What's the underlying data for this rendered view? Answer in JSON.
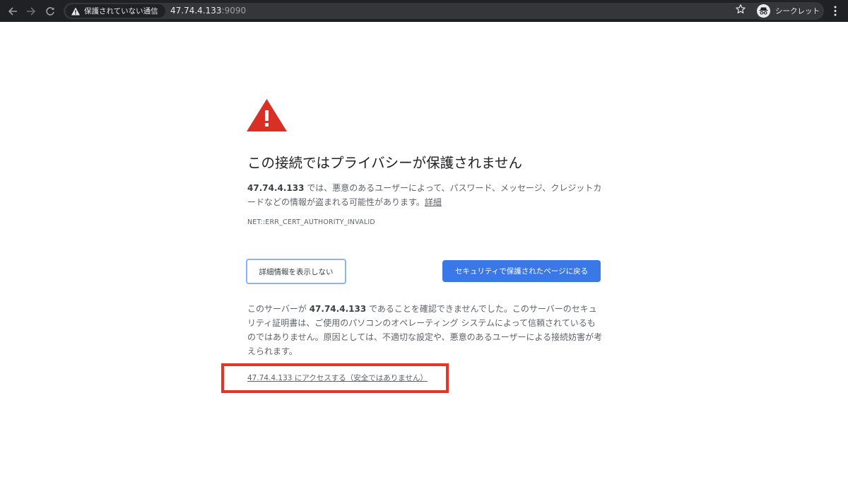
{
  "browser": {
    "security_chip_label": "保護されていない通信",
    "url_host": "47.74.4.133",
    "url_port": ":9090",
    "profile_label": "シークレット"
  },
  "page": {
    "title": "この接続ではプライバシーが保護されません",
    "intro_host": "47.74.4.133",
    "intro_text": " では、悪意のあるユーザーによって、パスワード、メッセージ、クレジットカードなどの情報が盗まれる可能性があります。",
    "details_link": "詳細",
    "error_code": "NET::ERR_CERT_AUTHORITY_INVALID",
    "hide_details_button": "詳細情報を表示しない",
    "back_to_safety_button": "セキュリティで保護されたページに戻る",
    "details_prefix": "このサーバーが ",
    "details_host": "47.74.4.133",
    "details_text": " であることを確認できませんでした。このサーバーのセキュリティ証明書は、ご使用のパソコンのオペレーティング システムによって信頼されているものではありません。原因としては、不適切な設定や、悪意のあるユーザーによる接続妨害が考えられます。",
    "proceed_link": "47.74.4.133 にアクセスする（安全ではありません）"
  },
  "colors": {
    "toolbar_bg": "#202124",
    "warning_red": "#d93025",
    "primary_button": "#3b78e7",
    "highlight_red": "#ea3323"
  },
  "icons": [
    "back-arrow-icon",
    "forward-arrow-icon",
    "reload-icon",
    "warning-triangle-icon",
    "bookmark-star-icon",
    "incognito-icon",
    "menu-dots-icon",
    "large-warning-icon"
  ]
}
